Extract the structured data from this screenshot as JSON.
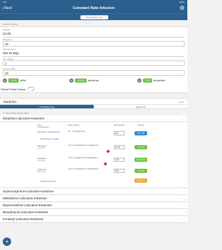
{
  "status": {
    "time": "9:41",
    "battery": "100%"
  },
  "nav": {
    "back_label": "Back",
    "title": "Constant Rate Infusion",
    "info_button": "Show Patient Info"
  },
  "entered_weight": {
    "section_label": "ENTER WEIGHT",
    "fields": [
      {
        "label": "Pounds",
        "value": "22.05"
      },
      {
        "label": "Kilograms",
        "value": "10"
      },
      {
        "label": "Set Fluid Size",
        "value": "250 ml Bag"
      },
      {
        "label": "Set ml/kg/hr",
        "value": "1"
      },
      {
        "label": "Set Drip Rate",
        "value": "10"
      }
    ]
  },
  "rates": [
    {
      "value": "10.00",
      "unit": "ml/hr"
    },
    {
      "value": "0.0333",
      "unit": "sec/drop"
    },
    {
      "value": "0.03",
      "unit": "drops/sec"
    }
  ],
  "feline": {
    "label": "Select Feline Doses"
  },
  "morphine": {
    "name": "Morphine",
    "cri": "CRI's"
  },
  "modes": {
    "multiple": "Or Multiple Drug",
    "single": "Single CRI"
  },
  "multi": {
    "section_label": "MULTIPLE DRUG CRI'S",
    "expanded": "Morphine-Lidocaine-Ketamine",
    "headers": {
      "drug": "Drug",
      "concentration": "Concentration",
      "dose_range": "Dose Range",
      "set_dosage": "Set Dosage",
      "volume": "Volume"
    },
    "rows": [
      {
        "name": "Morphine Loading Dose",
        "conc": "",
        "range": "0.1 - 0.5 mg/kg IV IM",
        "dose": "0.1",
        "volume": "0.07 ml",
        "vol_color": "blue",
        "link": "Select Dose In mg/kg"
      },
      {
        "name": "Morphine",
        "conc": "15 mg/ml",
        "range": "0.12 to 0.36mg/kg/hr (2 to 6ug/kg/min)",
        "dose": "0.12",
        "volume": "2.40 ml",
        "vol_color": "green",
        "link": ""
      },
      {
        "name": "Lidocaine",
        "conc": "20 mg/ml",
        "range": "0.6 to 3 mg/kg/hr (10 to 50ug/kg/min)",
        "dose": "1.5",
        "volume": "18.75 ml",
        "vol_color": "green",
        "link": ""
      },
      {
        "name": "Ketamine",
        "conc": "100 mg/ml",
        "range": "0.12 to 1.2mg/kg/hr (2 to 20ug/kg/min)",
        "dose": "0.6",
        "volume": "1.50 ml",
        "vol_color": "green",
        "link": ""
      }
    ],
    "total_link": "Volume to remove",
    "total_volume": "22.65 ml",
    "others": [
      "Hydromorphone-Lidocaine-Ketamine",
      "Methadone-Lidocaine-Ketamine",
      "Buprenorphine-Lidocaine-Ketamine",
      "Butorphanol-Lidocaine-Ketamine",
      "Fentanyl-Lidocaine-Ketamine"
    ]
  },
  "colors": {
    "primary": "#2b5f8e",
    "green": "#6cc04a",
    "blue": "#2a8dd4",
    "orange": "#f0a030"
  }
}
